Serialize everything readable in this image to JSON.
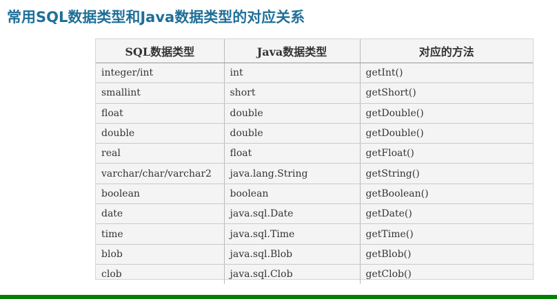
{
  "title": "常用SQL数据类型和Java数据类型的对应关系",
  "table": {
    "headers": [
      "SQL数据类型",
      "Java数据类型",
      "对应的方法"
    ],
    "rows": [
      [
        "integer/int",
        "int",
        "getInt()"
      ],
      [
        "smallint",
        "short",
        "getShort()"
      ],
      [
        "float",
        "double",
        "getDouble()"
      ],
      [
        "double",
        "double",
        "getDouble()"
      ],
      [
        "real",
        "float",
        "getFloat()"
      ],
      [
        "varchar/char/varchar2",
        "java.lang.String",
        "getString()"
      ],
      [
        "boolean",
        "boolean",
        "getBoolean()"
      ],
      [
        "date",
        "java.sql.Date",
        "getDate()"
      ],
      [
        "time",
        "java.sql.Time",
        "getTime()"
      ],
      [
        "blob",
        "java.sql.Blob",
        "getBlob()"
      ],
      [
        "clob",
        "java.sql.Clob",
        "getClob()"
      ]
    ]
  },
  "colors": {
    "title": "#1f6f98",
    "footer_bar": "#008000"
  }
}
